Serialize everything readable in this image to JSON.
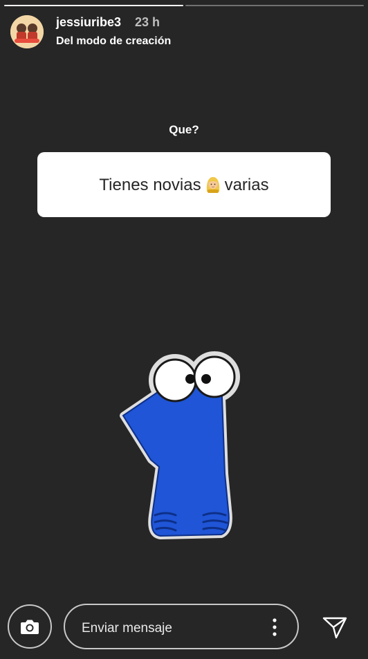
{
  "header": {
    "username": "jessiuribe3",
    "time_ago": "23 h",
    "subtitle": "Del modo de creación",
    "avatar_icon": "profile-photo"
  },
  "progress": {
    "segments": 2,
    "current": 1
  },
  "question_sticker": {
    "label": "Que?",
    "answer_before": "Tienes novias",
    "answer_emoji": "person-with-veil-emoji",
    "answer_after": "varias"
  },
  "sticker": {
    "icon": "number-one-character",
    "color": "#1f55d6"
  },
  "footer": {
    "camera_icon": "camera-icon",
    "message_placeholder": "Enviar mensaje",
    "more_icon": "more-vertical-icon",
    "send_icon": "send-icon"
  },
  "colors": {
    "background": "#262626",
    "card": "#ffffff",
    "text": "#ffffff"
  }
}
